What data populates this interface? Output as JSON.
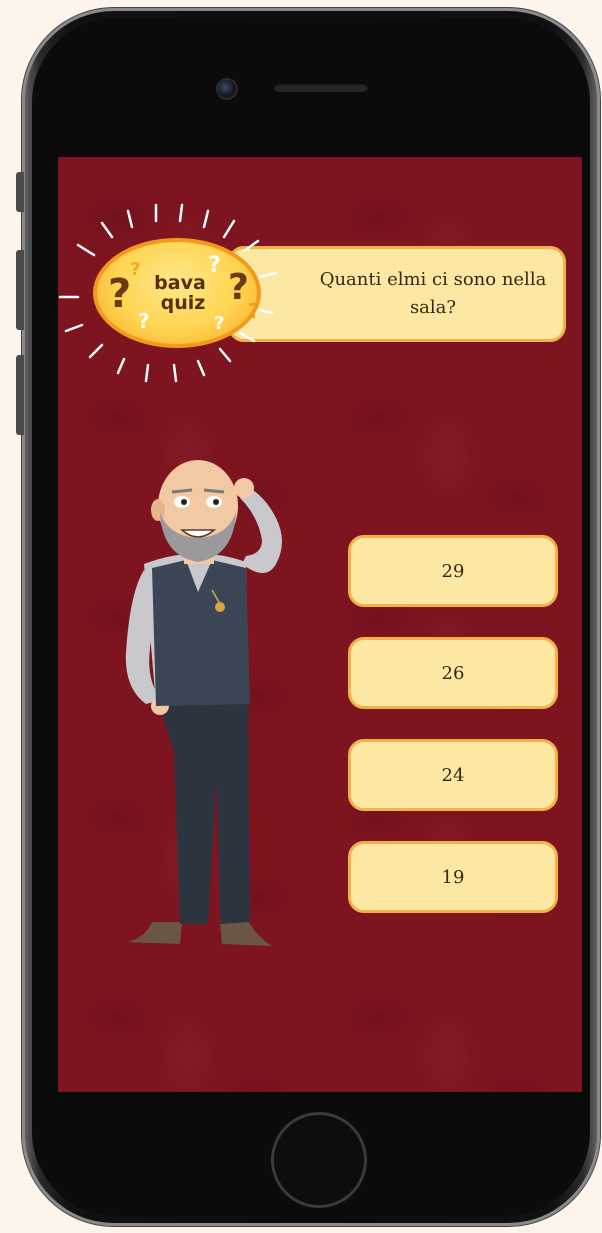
{
  "logo": {
    "line1": "bava",
    "line2": "quiz"
  },
  "question": {
    "text": "Quanti elmi ci sono nella sala?"
  },
  "answers": [
    {
      "label": "29"
    },
    {
      "label": "26"
    },
    {
      "label": "24"
    },
    {
      "label": "19"
    }
  ],
  "colors": {
    "background": "#7e1420",
    "panel": "#fde8a3",
    "panel_border": "#f1b24a",
    "logo_fill": "#ffd451"
  },
  "icons": [
    "question-mark-icon",
    "thinking-man-illustration"
  ]
}
